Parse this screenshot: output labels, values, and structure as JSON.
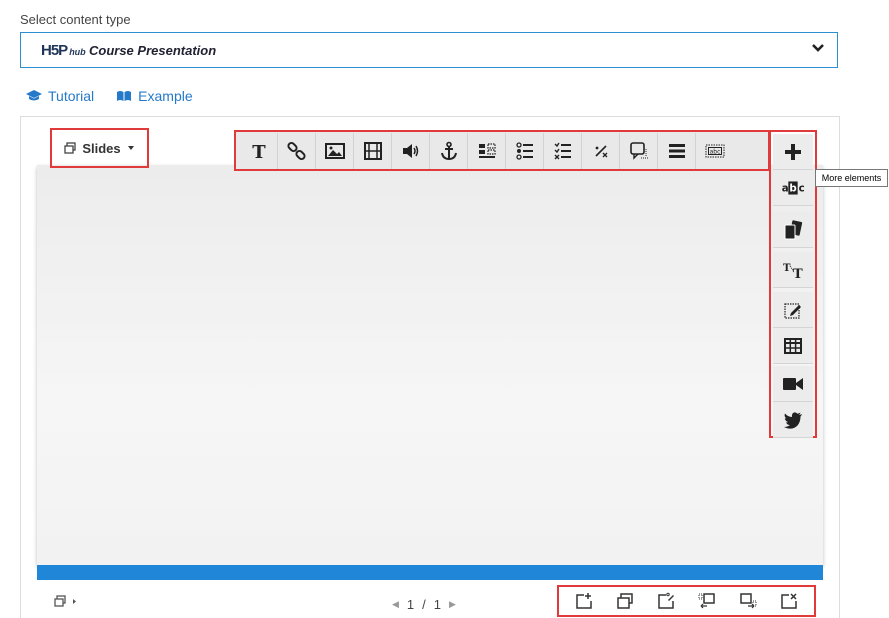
{
  "select": {
    "label": "Select content type",
    "logo": "H5P",
    "logo_suffix": "hub",
    "value": "Course Presentation"
  },
  "links": {
    "tutorial": "Tutorial",
    "example": "Example"
  },
  "slides_button": {
    "label": "Slides"
  },
  "toolbar_items": [
    "text",
    "link",
    "image",
    "video",
    "audio",
    "anchor",
    "drag-and-drop",
    "multiple-choice",
    "multi-select",
    "fill-in-blanks",
    "dialog-cards",
    "summary",
    "drag-text"
  ],
  "sidebar_items": [
    "more-elements",
    "mark-words",
    "memory-game",
    "drag-text",
    "single-choice-set",
    "table",
    "video",
    "twitter"
  ],
  "tooltip": "More elements",
  "pager": {
    "current": "1",
    "separator": "/",
    "total": "1"
  },
  "bottom_tools": [
    "new-slide",
    "clone-slide",
    "slide-background",
    "move-slide-left",
    "move-slide-right",
    "delete-slide"
  ],
  "colors": {
    "accent": "#1f86d8",
    "highlight": "#e03a3a",
    "link": "#2579c9"
  }
}
